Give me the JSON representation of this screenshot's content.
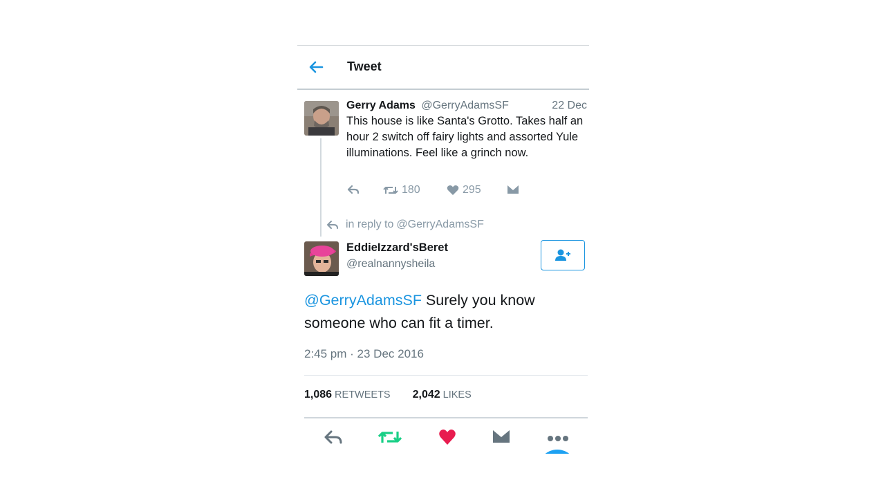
{
  "header": {
    "title": "Tweet"
  },
  "original_tweet": {
    "name": "Gerry Adams",
    "handle": "@GerryAdamsSF",
    "date": "22 Dec",
    "text": "This house is like Santa's Grotto. Takes half an hour 2 switch off fairy lights and assorted Yule illuminations. Feel like a grinch now.",
    "retweets": "180",
    "likes": "295"
  },
  "reply_context": {
    "label": "in reply to",
    "handle": "@GerryAdamsSF"
  },
  "reply_tweet": {
    "name": "EddieIzzard'sBeret",
    "handle": "@realnannysheila",
    "mention": "@GerryAdamsSF",
    "text": " Surely you know someone who can fit a timer.",
    "timestamp": "2:45 pm · 23 Dec 2016",
    "retweets_count": "1,086",
    "retweets_label": "RETWEETS",
    "likes_count": "2,042",
    "likes_label": "LIKES"
  },
  "colors": {
    "accent": "#1b95e0",
    "retweet_green": "#19cf86",
    "like_red": "#e81c4f",
    "muted": "#66757f"
  },
  "icons": [
    "back-arrow-icon",
    "reply-icon",
    "retweet-icon",
    "heart-icon",
    "message-icon",
    "follow-icon",
    "more-icon"
  ]
}
